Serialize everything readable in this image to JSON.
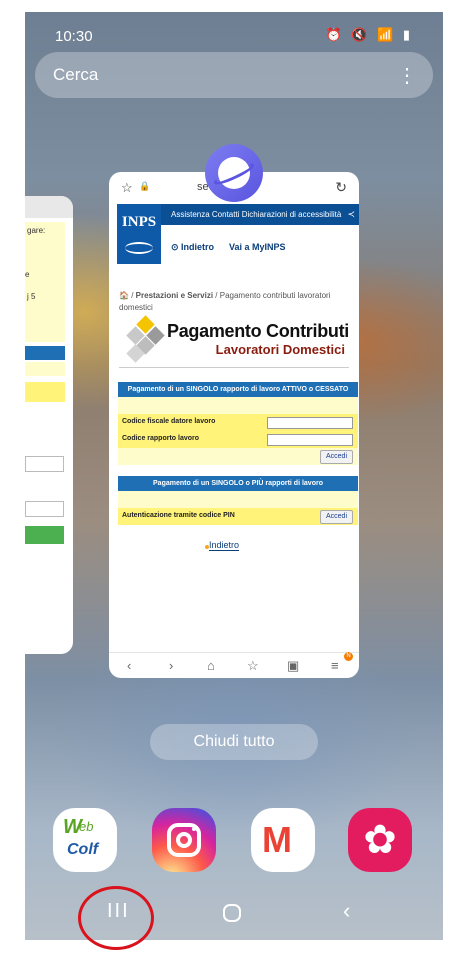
{
  "status_bar": {
    "time": "10:30",
    "icons": "⏰ 🔇 📶 ▮"
  },
  "search": {
    "placeholder": "Cerca"
  },
  "left_card": {
    "text1": "gare:",
    "text2": "e",
    "text3": "j 5"
  },
  "browser": {
    "url": "se……ps.it",
    "inps": {
      "logo_text": "INPS",
      "topline": "Assistenza  Contatti  Dichiarazioni di accessibilità",
      "back": "Indietro",
      "myinps": "Vai a MyINPS"
    },
    "breadcrumb": {
      "home": "🏠",
      "sep": "/",
      "section": "Prestazioni e Servizi",
      "page": "Pagamento contributi lavoratori domestici"
    },
    "title": "Pagamento Contributi",
    "subtitle": "Lavoratori Domestici",
    "section1": {
      "header": "Pagamento di un SINGOLO rapporto di lavoro ATTIVO o CESSATO",
      "field1_label": "Codice fiscale datore lavoro",
      "field2_label": "Codice rapporto lavoro",
      "button": "Accedi"
    },
    "section2": {
      "header": "Pagamento di un SINGOLO o PIÙ rapporti di lavoro",
      "field_label": "Autenticazione tramite codice PIN",
      "button": "Accedi"
    },
    "back_link": "Indietro",
    "toolbar": {
      "back": "‹",
      "forward": "›",
      "home": "⌂",
      "bookmark": "☆",
      "tabs": "▣",
      "menu": "≡",
      "badge": "N"
    }
  },
  "close_all": "Chiudi tutto",
  "dock": {
    "webcolf": {
      "w": "W",
      "eb": "eb",
      "colf": "Colf"
    },
    "gmail": "M",
    "gallery": "✿"
  },
  "navigation": {
    "recents": "III",
    "back": "‹"
  }
}
